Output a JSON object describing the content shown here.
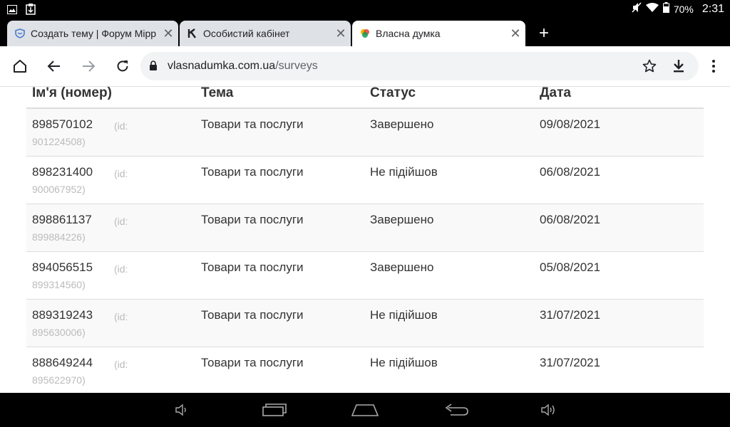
{
  "status_bar": {
    "battery": "70%",
    "time": "2:31"
  },
  "tabs": [
    {
      "title": "Создать тему | Форум Мірр",
      "favicon": "shield-favicon-icon",
      "active": false
    },
    {
      "title": "Особистий кабінет",
      "favicon": "k-favicon-icon",
      "active": false
    },
    {
      "title": "Власна думка",
      "favicon": "vlasna-dumka-favicon-icon",
      "active": true
    }
  ],
  "tab_close_glyph": "✕",
  "new_tab_glyph": "+",
  "toolbar": {
    "url_host": "vlasnadumka.com.ua",
    "url_path": "/surveys"
  },
  "table": {
    "headers": [
      "Ім'я (номер)",
      "Тема",
      "Статус",
      "Дата"
    ],
    "id_prefix": "(id:",
    "rows": [
      {
        "name": "898570102",
        "id": "901224508)",
        "topic": "Товари та послуги",
        "status": "Завершено",
        "date": "09/08/2021"
      },
      {
        "name": "898231400",
        "id": "900067952)",
        "topic": "Товари та послуги",
        "status": "Не підійшов",
        "date": "06/08/2021"
      },
      {
        "name": "898861137",
        "id": "899884226)",
        "topic": "Товари та послуги",
        "status": "Завершено",
        "date": "06/08/2021"
      },
      {
        "name": "894056515",
        "id": "899314560)",
        "topic": "Товари та послуги",
        "status": "Завершено",
        "date": "05/08/2021"
      },
      {
        "name": "889319243",
        "id": "895630006)",
        "topic": "Товари та послуги",
        "status": "Не підійшов",
        "date": "31/07/2021"
      },
      {
        "name": "888649244",
        "id": "895622970)",
        "topic": "Товари та послуги",
        "status": "Не підійшов",
        "date": "31/07/2021"
      }
    ]
  },
  "colors": {
    "tab_inactive": "#dee1e6",
    "omnibox": "#f1f3f4",
    "row_stripe": "#f9f9f9",
    "id_text": "#bbbbbb"
  }
}
